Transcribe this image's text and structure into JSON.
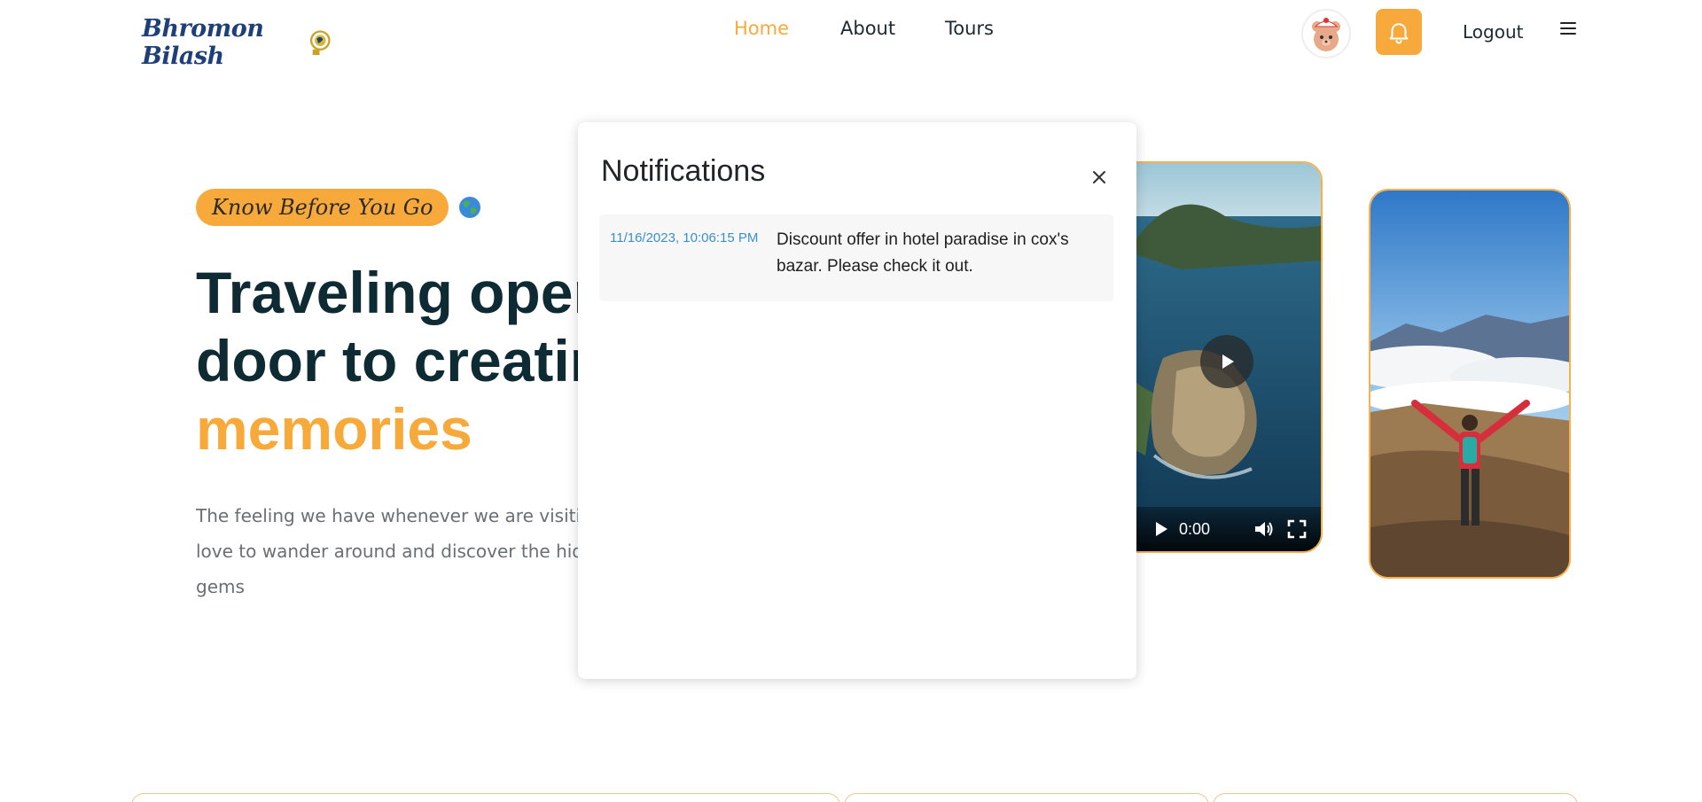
{
  "header": {
    "logo_text": "Bhromon Bilash",
    "nav": [
      {
        "label": "Home",
        "active": true
      },
      {
        "label": "About"
      },
      {
        "label": "Tours"
      }
    ],
    "logout_label": "Logout",
    "icons": {
      "bell": "bell-icon",
      "menu": "hamburger-menu-icon",
      "avatar": "user-avatar"
    }
  },
  "hero": {
    "badge": "Know Before You Go",
    "title_line1": "Traveling open",
    "title_line2": "door to creatin",
    "title_accent": "memories",
    "description": "The feeling we have whenever we are visiting love to wander around and discover the hidc gems"
  },
  "video": {
    "time": "0:00"
  },
  "modal": {
    "title": "Notifications",
    "notifications": [
      {
        "time": "11/16/2023, 10:06:15 PM",
        "message": "Discount offer in hotel paradise in cox's bazar. Please check it out."
      }
    ]
  },
  "colors": {
    "accent": "#f8a93b",
    "title": "#0e2a33",
    "link_time": "#3a8fd1"
  }
}
